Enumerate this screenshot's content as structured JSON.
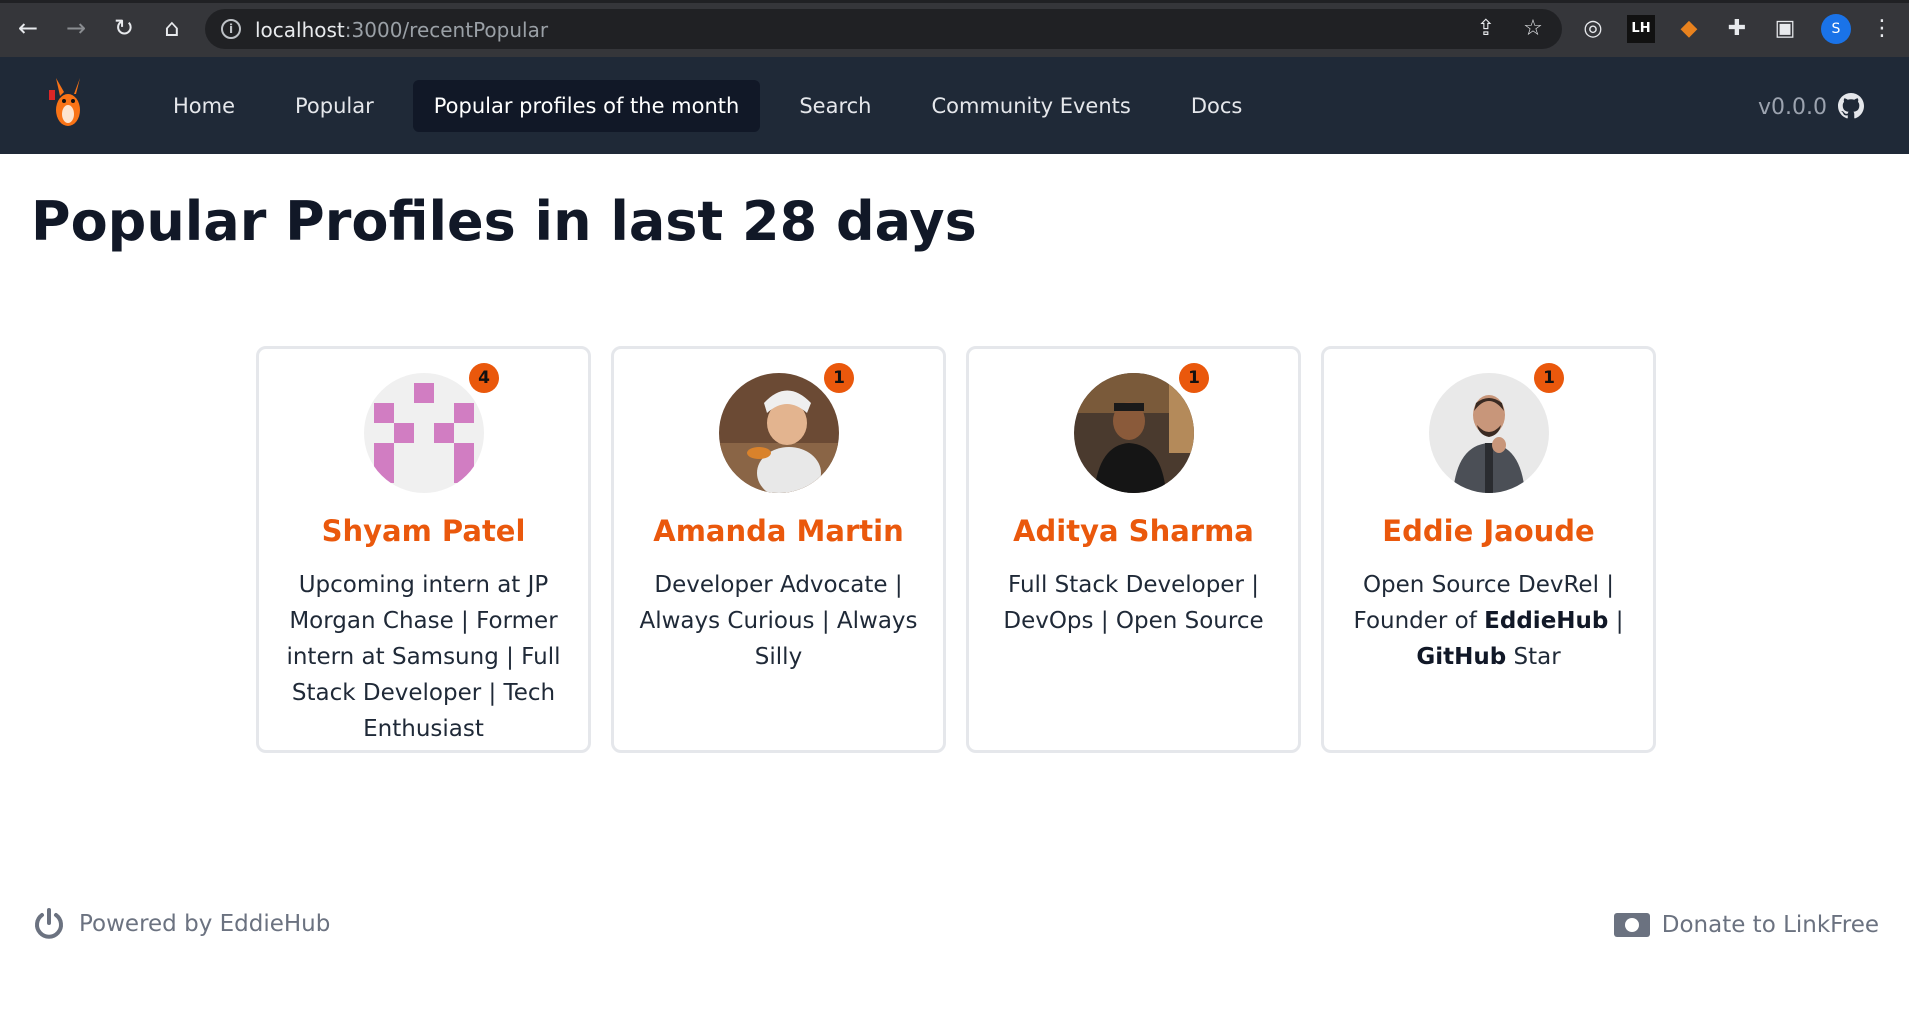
{
  "browser": {
    "url_host": "localhost",
    "url_rest": ":3000/recentPopular",
    "profile_initial": "S",
    "ext_lh": "LH"
  },
  "nav": {
    "items": [
      {
        "label": "Home",
        "active": false
      },
      {
        "label": "Popular",
        "active": false
      },
      {
        "label": "Popular profiles of the month",
        "active": true
      },
      {
        "label": "Search",
        "active": false
      },
      {
        "label": "Community Events",
        "active": false
      },
      {
        "label": "Docs",
        "active": false
      }
    ],
    "version": "v0.0.0"
  },
  "page": {
    "title": "Popular Profiles in last 28 days"
  },
  "profiles": [
    {
      "name": "Shyam Patel",
      "count": "4",
      "bio": "Upcoming intern at JP Morgan Chase | Former intern at Samsung | Full Stack Developer | Tech Enthusiast"
    },
    {
      "name": "Amanda Martin",
      "count": "1",
      "bio": "Developer Advocate | Always Curious | Always Silly"
    },
    {
      "name": "Aditya Sharma",
      "count": "1",
      "bio": "Full Stack Developer | DevOps | Open Source"
    },
    {
      "name": "Eddie Jaoude",
      "count": "1",
      "bio_parts": [
        "Open Source DevRel | Founder of ",
        "EddieHub",
        " | ",
        "GitHub",
        " Star"
      ]
    }
  ],
  "footer": {
    "powered": "Powered by EddieHub",
    "donate": "Donate to LinkFree"
  },
  "colors": {
    "accent": "#ea580c",
    "nav_bg": "#1f2937",
    "nav_active": "#111827"
  }
}
